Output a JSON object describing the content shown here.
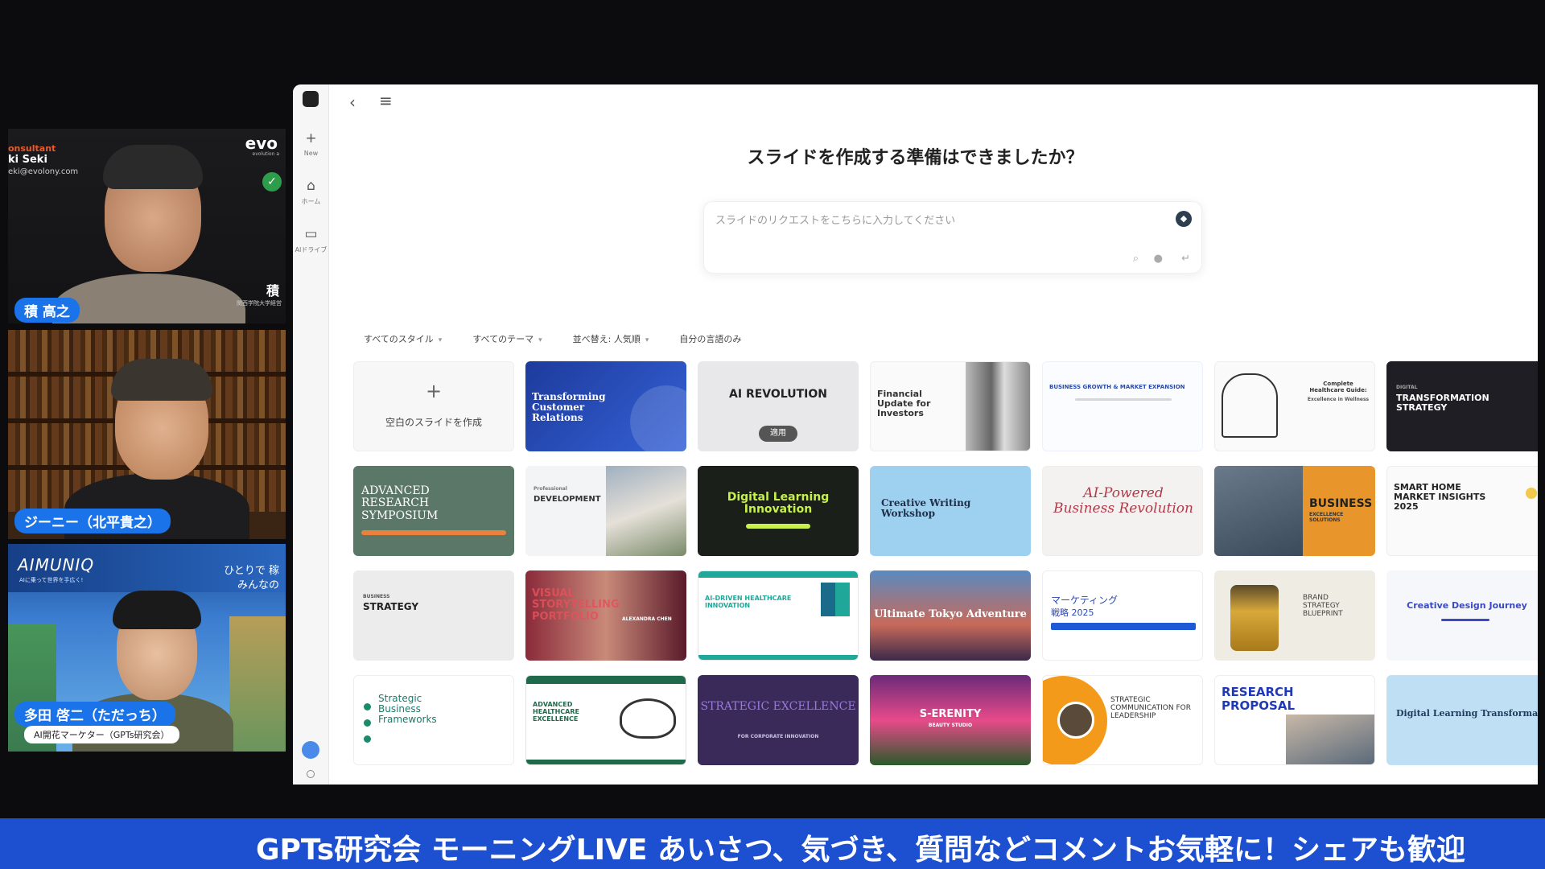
{
  "participants": {
    "p1": {
      "name": "積 高之",
      "role_fragment": "onsultant",
      "name_fragment": "ki Seki",
      "email_fragment": "eki@evolony.com",
      "logo_fragment": "evo",
      "logo_sub": "evolution a",
      "side_kanji": "積",
      "side_caption": "関西学院大学経営"
    },
    "p2": {
      "name": "ジーニー（北平貴之）"
    },
    "p3": {
      "name": "多田 啓二（ただっち）",
      "subtitle": "AI開花マーケター（GPTs研究会）",
      "brand": "AIMUNIQ",
      "brand_sub": "AIに乗って世界を手広く!",
      "banner_right_1": "ひとりで 稼",
      "banner_right_2": "みんなの"
    }
  },
  "app": {
    "rail": {
      "new_label": "New",
      "home_label": "ホーム",
      "drive_label": "AIドライブ"
    },
    "heading": "スライドを作成する準備はできましたか？",
    "prompt": {
      "placeholder": "スライドのリクエストをこちらに入力してください"
    },
    "filters": {
      "style": "すべてのスタイル",
      "theme": "すべてのテーマ",
      "sort": "並べ替え: 人気順",
      "own_lang": "自分の言語のみ"
    },
    "create_blank": "空白のスライドを作成",
    "apply_label": "適用",
    "templates": {
      "r1c1": "Transforming Customer Relations",
      "r1c2": "AI REVOLUTION",
      "r1c3": "Financial Update for Investors",
      "r1c4": "BUSINESS GROWTH & MARKET EXPANSION",
      "r1c5": "Complete Healthcare Guide:",
      "r1c5b": "Excellence in Wellness",
      "r1c6a": "DIGITAL",
      "r1c6": "TRANSFORMATION STRATEGY",
      "r2c0": "ADVANCED RESEARCH SYMPOSIUM",
      "r2c1a": "Professional",
      "r2c1": "DEVELOPMENT",
      "r2c2": "Digital Learning Innovation",
      "r2c3": "Creative Writing Workshop",
      "r2c4": "AI-Powered Business Revolution",
      "r2c5": "BUSINESS",
      "r2c5b": "EXCELLENCE SOLUTIONS",
      "r2c6": "SMART HOME MARKET INSIGHTS 2025",
      "r3c0": "STRATEGY",
      "r3c0a": "BUSINESS",
      "r3c1": "VISUAL STORYTELLING PORTFOLIO",
      "r3c1b": "ALEXANDRA CHEN",
      "r3c2": "AI-DRIVEN HEALTHCARE INNOVATION",
      "r3c3": "Ultimate Tokyo Adventure",
      "r3c4a": "マーケティング",
      "r3c4": "戦略 2025",
      "r3c5": "BRAND STRATEGY BLUEPRINT",
      "r3c6": "Creative Design Journey",
      "r4c0": "Strategic Business Frameworks",
      "r4c1": "ADVANCED HEALTHCARE EXCELLENCE",
      "r4c2": "STRATEGIC EXCELLENCE",
      "r4c2b": "FOR CORPORATE INNOVATION",
      "r4c3": "S-ERENITY",
      "r4c3b": "BEAUTY STUDIO",
      "r4c4": "STRATEGIC COMMUNICATION FOR LEADERSHIP",
      "r4c5": "RESEARCH PROPOSAL",
      "r4c6": "Digital Learning Transformation"
    }
  },
  "ticker": "GPTs研究会 モーニングLIVE あいさつ、気づき、質問などコメントお気軽に！シェアも歓迎"
}
